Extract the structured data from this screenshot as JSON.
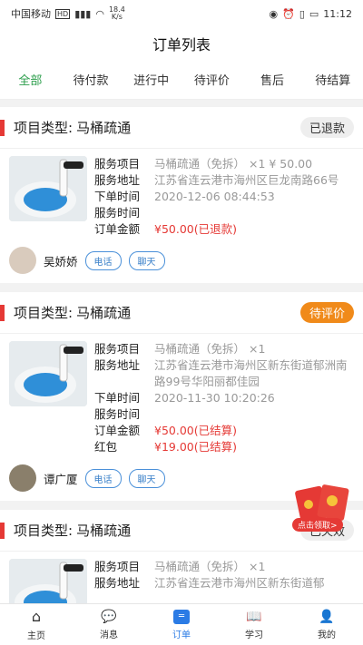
{
  "status_bar": {
    "carrier": "中国移动",
    "speed_value": "18.4",
    "speed_unit": "K/s",
    "time": "11:12"
  },
  "header": {
    "title": "订单列表"
  },
  "tabs": [
    "全部",
    "待付款",
    "进行中",
    "待评价",
    "售后",
    "待结算"
  ],
  "orders": [
    {
      "type_label": "项目类型:",
      "type_value": "马桶疏通",
      "status": "已退款",
      "rows": [
        {
          "k": "服务项目",
          "v": "马桶疏通（免拆）  ×1  ¥ 50.00"
        },
        {
          "k": "服务地址",
          "v": "江苏省连云港市海州区巨龙南路66号"
        },
        {
          "k": "下单时间",
          "v": "2020-12-06 08:44:53"
        },
        {
          "k": "服务时间",
          "v": ""
        },
        {
          "k": "订单金额",
          "v": "¥50.00(已退款)",
          "red": true
        }
      ],
      "customer": "吴娇娇",
      "phone_label": "电话",
      "chat_label": "聊天"
    },
    {
      "type_label": "项目类型:",
      "type_value": "马桶疏通",
      "status": "待评价",
      "rows": [
        {
          "k": "服务项目",
          "v": "马桶疏通（免拆）  ×1"
        },
        {
          "k": "服务地址",
          "v": "江苏省连云港市海州区新东街道郁洲南路99号华阳丽都佳园"
        },
        {
          "k": "下单时间",
          "v": "2020-11-30 10:20:26"
        },
        {
          "k": "服务时间",
          "v": ""
        },
        {
          "k": "订单金额",
          "v": "¥50.00(已结算)",
          "red": true
        },
        {
          "k": "红包",
          "v": "¥19.00(已结算)",
          "red": true
        }
      ],
      "customer": "谭广厦",
      "phone_label": "电话",
      "chat_label": "聊天"
    },
    {
      "type_label": "项目类型:",
      "type_value": "马桶疏通",
      "status": "已失效",
      "rows": [
        {
          "k": "服务项目",
          "v": "马桶疏通（免拆）  ×1"
        },
        {
          "k": "服务地址",
          "v": "江苏省连云港市海州区新东街道郁"
        }
      ]
    }
  ],
  "redpacket": {
    "label": "点击领取>"
  },
  "bottom_nav": [
    "主页",
    "消息",
    "订单",
    "学习",
    "我的"
  ],
  "colors": {
    "accent_green": "#2a9d4a",
    "accent_red": "#e53935",
    "accent_orange": "#f08a1a",
    "accent_blue": "#2b7be5"
  }
}
